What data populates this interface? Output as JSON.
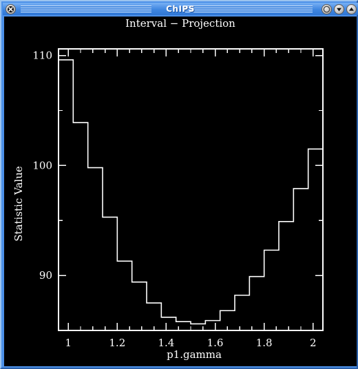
{
  "window": {
    "title": "ChIPS",
    "buttons": [
      {
        "name": "close-button",
        "icon": "close-x-icon"
      },
      {
        "name": "iconify-button",
        "icon": "circle-icon"
      },
      {
        "name": "lower-button",
        "icon": "triangle-down-icon"
      },
      {
        "name": "raise-button",
        "icon": "triangle-up-icon"
      }
    ]
  },
  "chart_data": {
    "type": "line",
    "style": "step",
    "title": "Interval − Projection",
    "xlabel": "p1.gamma",
    "ylabel": "Statistic Value",
    "xlim": [
      0.96,
      2.04
    ],
    "ylim": [
      85.0,
      110.6
    ],
    "grid": false,
    "legend": null,
    "xticks": [
      1,
      1.2,
      1.4,
      1.6,
      1.8,
      2
    ],
    "xtick_labels": [
      "1",
      "1.2",
      "1.4",
      "1.6",
      "1.8",
      "2"
    ],
    "x_minor_per_major": 4,
    "yticks": [
      90,
      100,
      110
    ],
    "ytick_labels": [
      "90",
      "100",
      "110"
    ],
    "y_minor_per_major": 2,
    "x_edges": [
      0.96,
      1.02,
      1.08,
      1.14,
      1.2,
      1.26,
      1.32,
      1.38,
      1.44,
      1.5,
      1.56,
      1.62,
      1.68,
      1.74,
      1.8,
      1.86,
      1.92,
      1.98,
      2.04
    ],
    "values": [
      109.6,
      103.9,
      99.8,
      95.3,
      91.3,
      89.4,
      87.5,
      86.2,
      85.8,
      85.6,
      85.9,
      86.8,
      88.2,
      89.9,
      92.3,
      94.9,
      97.9,
      101.5
    ],
    "x_centers": [
      0.99,
      1.05,
      1.11,
      1.17,
      1.23,
      1.29,
      1.35,
      1.41,
      1.47,
      1.53,
      1.59,
      1.65,
      1.71,
      1.77,
      1.83,
      1.89,
      1.95,
      2.01
    ],
    "colors": {
      "background": "#000000",
      "foreground": "#ffffff",
      "curve": "#ffffff"
    }
  }
}
